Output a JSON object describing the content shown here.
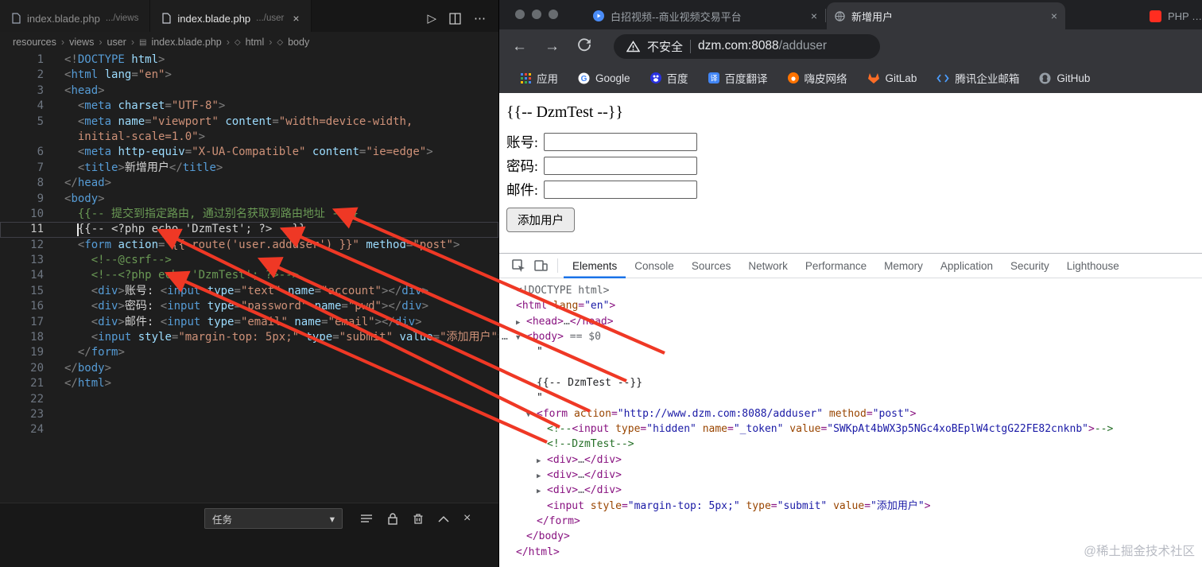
{
  "icons": {
    "close": "×",
    "run": "▷",
    "more": "⋯",
    "caret": "▾",
    "crumb_sep": "›",
    "tri_right": "▶",
    "tri_down": "▼",
    "back": "←",
    "forward": "→",
    "body_overflow": "…"
  },
  "colors": {
    "annotation_arrow": "#ef3825",
    "devtools_accent": "#1a73e8",
    "editor_bg": "#1e1e1e",
    "chrome_dark": "#35363a"
  },
  "editor": {
    "tabs": [
      {
        "title": "index.blade.php",
        "dir": ".../views"
      },
      {
        "title": "index.blade.php",
        "dir": ".../user"
      }
    ],
    "breadcrumb": [
      "resources",
      "views",
      "user",
      "index.blade.php",
      "html",
      "body"
    ],
    "panel": {
      "dropdown": "任务"
    },
    "lines": [
      {
        "n": "1",
        "t": [
          [
            "p",
            "<!"
          ],
          [
            "t",
            "DOCTYPE"
          ],
          [
            "a",
            " html"
          ],
          [
            "p",
            ">"
          ]
        ]
      },
      {
        "n": "2",
        "t": [
          [
            "p",
            "<"
          ],
          [
            "t",
            "html"
          ],
          [
            "a",
            " lang"
          ],
          [
            "p",
            "="
          ],
          [
            "v",
            "\"en\""
          ],
          [
            "p",
            ">"
          ]
        ]
      },
      {
        "n": "3",
        "t": [
          [
            "p",
            "<"
          ],
          [
            "t",
            "head"
          ],
          [
            "p",
            ">"
          ]
        ]
      },
      {
        "n": "4",
        "t": [
          [
            "w",
            "  "
          ],
          [
            "p",
            "<"
          ],
          [
            "t",
            "meta"
          ],
          [
            "a",
            " charset"
          ],
          [
            "p",
            "="
          ],
          [
            "v",
            "\"UTF-8\""
          ],
          [
            "p",
            ">"
          ]
        ]
      },
      {
        "n": "5",
        "t": [
          [
            "w",
            "  "
          ],
          [
            "p",
            "<"
          ],
          [
            "t",
            "meta"
          ],
          [
            "a",
            " name"
          ],
          [
            "p",
            "="
          ],
          [
            "v",
            "\"viewport\""
          ],
          [
            "a",
            " content"
          ],
          [
            "p",
            "="
          ],
          [
            "v",
            "\"width=device-width,"
          ]
        ]
      },
      {
        "n": "",
        "t": [
          [
            "w",
            "  "
          ],
          [
            "v",
            "initial-scale=1.0\""
          ],
          [
            "p",
            ">"
          ]
        ]
      },
      {
        "n": "6",
        "t": [
          [
            "w",
            "  "
          ],
          [
            "p",
            "<"
          ],
          [
            "t",
            "meta"
          ],
          [
            "a",
            " http-equiv"
          ],
          [
            "p",
            "="
          ],
          [
            "v",
            "\"X-UA-Compatible\""
          ],
          [
            "a",
            " content"
          ],
          [
            "p",
            "="
          ],
          [
            "v",
            "\"ie=edge\""
          ],
          [
            "p",
            ">"
          ]
        ]
      },
      {
        "n": "7",
        "t": [
          [
            "w",
            "  "
          ],
          [
            "p",
            "<"
          ],
          [
            "t",
            "title"
          ],
          [
            "p",
            ">"
          ],
          [
            "w",
            "新增用户"
          ],
          [
            "p",
            "</"
          ],
          [
            "t",
            "title"
          ],
          [
            "p",
            ">"
          ]
        ]
      },
      {
        "n": "8",
        "t": [
          [
            "p",
            "</"
          ],
          [
            "t",
            "head"
          ],
          [
            "p",
            ">"
          ]
        ]
      },
      {
        "n": "9",
        "t": [
          [
            "p",
            "<"
          ],
          [
            "t",
            "body"
          ],
          [
            "p",
            ">"
          ]
        ]
      },
      {
        "n": "10",
        "t": [
          [
            "w",
            "  "
          ],
          [
            "c",
            "{{-- 提交到指定路由, 通过别名获取到路由地址 --}}"
          ]
        ]
      },
      {
        "n": "11",
        "cur": true,
        "t": [
          [
            "w",
            "  {{-- <?php echo 'DzmTest'; ?> --}}"
          ]
        ]
      },
      {
        "n": "12",
        "t": [
          [
            "w",
            "  "
          ],
          [
            "p",
            "<"
          ],
          [
            "t",
            "form"
          ],
          [
            "a",
            " action"
          ],
          [
            "p",
            "="
          ],
          [
            "v",
            "\"{{ route('user.adduser') }}\""
          ],
          [
            "a",
            " method"
          ],
          [
            "p",
            "="
          ],
          [
            "v",
            "\"post\""
          ],
          [
            "p",
            ">"
          ]
        ]
      },
      {
        "n": "13",
        "t": [
          [
            "w",
            "    "
          ],
          [
            "c",
            "<!--@csrf-->"
          ]
        ]
      },
      {
        "n": "14",
        "t": [
          [
            "w",
            "    "
          ],
          [
            "c",
            "<!--<?php echo 'DzmTest'; ?>-->"
          ]
        ]
      },
      {
        "n": "15",
        "t": [
          [
            "w",
            "    "
          ],
          [
            "p",
            "<"
          ],
          [
            "t",
            "div"
          ],
          [
            "p",
            ">"
          ],
          [
            "w",
            "账号: "
          ],
          [
            "p",
            "<"
          ],
          [
            "t",
            "input"
          ],
          [
            "a",
            " type"
          ],
          [
            "p",
            "="
          ],
          [
            "v",
            "\"text\""
          ],
          [
            "a",
            " name"
          ],
          [
            "p",
            "="
          ],
          [
            "v",
            "\"account\""
          ],
          [
            "p",
            "></"
          ],
          [
            "t",
            "div"
          ],
          [
            "p",
            ">"
          ]
        ]
      },
      {
        "n": "16",
        "t": [
          [
            "w",
            "    "
          ],
          [
            "p",
            "<"
          ],
          [
            "t",
            "div"
          ],
          [
            "p",
            ">"
          ],
          [
            "w",
            "密码: "
          ],
          [
            "p",
            "<"
          ],
          [
            "t",
            "input"
          ],
          [
            "a",
            " type"
          ],
          [
            "p",
            "="
          ],
          [
            "v",
            "\"password\""
          ],
          [
            "a",
            " name"
          ],
          [
            "p",
            "="
          ],
          [
            "v",
            "\"pwd\""
          ],
          [
            "p",
            "></"
          ],
          [
            "t",
            "div"
          ],
          [
            "p",
            ">"
          ]
        ]
      },
      {
        "n": "17",
        "t": [
          [
            "w",
            "    "
          ],
          [
            "p",
            "<"
          ],
          [
            "t",
            "div"
          ],
          [
            "p",
            ">"
          ],
          [
            "w",
            "邮件: "
          ],
          [
            "p",
            "<"
          ],
          [
            "t",
            "input"
          ],
          [
            "a",
            " type"
          ],
          [
            "p",
            "="
          ],
          [
            "v",
            "\"email\""
          ],
          [
            "a",
            " name"
          ],
          [
            "p",
            "="
          ],
          [
            "v",
            "\"email\""
          ],
          [
            "p",
            "></"
          ],
          [
            "t",
            "div"
          ],
          [
            "p",
            ">"
          ]
        ]
      },
      {
        "n": "18",
        "t": [
          [
            "w",
            "    "
          ],
          [
            "p",
            "<"
          ],
          [
            "t",
            "input"
          ],
          [
            "a",
            " style"
          ],
          [
            "p",
            "="
          ],
          [
            "v",
            "\"margin-top: 5px;\""
          ],
          [
            "a",
            " type"
          ],
          [
            "p",
            "="
          ],
          [
            "v",
            "\"submit\""
          ],
          [
            "a",
            " value"
          ],
          [
            "p",
            "="
          ],
          [
            "v",
            "\"添加用户\""
          ],
          [
            "p",
            ">"
          ]
        ]
      },
      {
        "n": "19",
        "t": [
          [
            "w",
            "  "
          ],
          [
            "p",
            "</"
          ],
          [
            "t",
            "form"
          ],
          [
            "p",
            ">"
          ]
        ]
      },
      {
        "n": "20",
        "t": [
          [
            "p",
            "</"
          ],
          [
            "t",
            "body"
          ],
          [
            "p",
            ">"
          ]
        ]
      },
      {
        "n": "21",
        "t": [
          [
            "p",
            "</"
          ],
          [
            "t",
            "html"
          ],
          [
            "p",
            ">"
          ]
        ]
      },
      {
        "n": "22",
        "t": []
      },
      {
        "n": "23",
        "t": []
      },
      {
        "n": "24",
        "t": []
      }
    ]
  },
  "browser": {
    "tabs": [
      {
        "title": "白招视频--商业视频交易平台"
      },
      {
        "title": "新增用户"
      },
      {
        "title": "PHP - Laravel"
      }
    ],
    "nav": {
      "security": "不安全",
      "host": "dzm.com:8088",
      "path": "/adduser"
    },
    "bookmarks": [
      "应用",
      "Google",
      "百度",
      "百度翻译",
      "嗨皮网络",
      "GitLab",
      "腾讯企业邮箱",
      "GitHub"
    ],
    "page": {
      "heading": "{{-- DzmTest --}}",
      "fields": [
        "账号:",
        "密码:",
        "邮件:"
      ],
      "submit": "添加用户"
    },
    "devtools": {
      "tabs": [
        "Elements",
        "Console",
        "Sources",
        "Network",
        "Performance",
        "Memory",
        "Application",
        "Security",
        "Lighthouse"
      ],
      "active_tab": "Elements",
      "watermark": "@稀土掘金技术社区",
      "dom": [
        {
          "i": 0,
          "a": "",
          "t": [
            [
              "dg",
              "<!DOCTYPE html>"
            ]
          ]
        },
        {
          "i": 0,
          "a": "",
          "t": [
            [
              "dt",
              "<html"
            ],
            [
              "da",
              " lang"
            ],
            [
              "dt",
              "="
            ],
            [
              "dv",
              "\"en\""
            ],
            [
              "dt",
              ">"
            ]
          ]
        },
        {
          "i": 1,
          "a": "r",
          "t": [
            [
              "dt",
              "<head>"
            ],
            [
              "dg",
              "…"
            ],
            [
              "dt",
              "</head>"
            ]
          ]
        },
        {
          "i": 1,
          "a": "d",
          "pre": "…",
          "t": [
            [
              "dt",
              "<body>"
            ],
            [
              "dg",
              " == $0"
            ]
          ]
        },
        {
          "i": 2,
          "a": "",
          "t": [
            [
              "dk",
              "\""
            ]
          ]
        },
        {
          "i": 2,
          "a": "",
          "t": []
        },
        {
          "i": 2,
          "a": "",
          "t": [
            [
              "dk",
              "{{-- DzmTest --}}"
            ]
          ]
        },
        {
          "i": 2,
          "a": "",
          "t": [
            [
              "dk",
              "\""
            ]
          ]
        },
        {
          "i": 2,
          "a": "d",
          "t": [
            [
              "dt",
              "<form"
            ],
            [
              "da",
              " action"
            ],
            [
              "dt",
              "="
            ],
            [
              "dv",
              "\"http://www.dzm.com:8088/adduser\""
            ],
            [
              "da",
              " method"
            ],
            [
              "dt",
              "="
            ],
            [
              "dv",
              "\"post\""
            ],
            [
              "dt",
              ">"
            ]
          ]
        },
        {
          "i": 3,
          "a": "",
          "t": [
            [
              "dc",
              "<!--"
            ],
            [
              "dt",
              "<input"
            ],
            [
              "da",
              " type"
            ],
            [
              "dt",
              "="
            ],
            [
              "dv",
              "\"hidden\""
            ],
            [
              "da",
              " name"
            ],
            [
              "dt",
              "="
            ],
            [
              "dv",
              "\"_token\""
            ],
            [
              "da",
              " value"
            ],
            [
              "dt",
              "="
            ],
            [
              "dv",
              "\"SWKpAt4bWX3p5NGc4xoBEplW4ctgG22FE82cnknb\""
            ],
            [
              "dt",
              ">"
            ],
            [
              "dc",
              "-->"
            ]
          ]
        },
        {
          "i": 3,
          "a": "",
          "t": [
            [
              "dc",
              "<!--DzmTest-->"
            ]
          ]
        },
        {
          "i": 3,
          "a": "r",
          "t": [
            [
              "dt",
              "<div>"
            ],
            [
              "dg",
              "…"
            ],
            [
              "dt",
              "</div>"
            ]
          ]
        },
        {
          "i": 3,
          "a": "r",
          "t": [
            [
              "dt",
              "<div>"
            ],
            [
              "dg",
              "…"
            ],
            [
              "dt",
              "</div>"
            ]
          ]
        },
        {
          "i": 3,
          "a": "r",
          "t": [
            [
              "dt",
              "<div>"
            ],
            [
              "dg",
              "…"
            ],
            [
              "dt",
              "</div>"
            ]
          ]
        },
        {
          "i": 3,
          "a": "",
          "t": [
            [
              "dt",
              "<input"
            ],
            [
              "da",
              " style"
            ],
            [
              "dt",
              "="
            ],
            [
              "dv",
              "\"margin-top: 5px;\""
            ],
            [
              "da",
              " type"
            ],
            [
              "dt",
              "="
            ],
            [
              "dv",
              "\"submit\""
            ],
            [
              "da",
              " value"
            ],
            [
              "dt",
              "="
            ],
            [
              "dv",
              "\"添加用户\""
            ],
            [
              "dt",
              ">"
            ]
          ]
        },
        {
          "i": 2,
          "a": "",
          "t": [
            [
              "dt",
              "</form>"
            ]
          ]
        },
        {
          "i": 1,
          "a": "",
          "t": [
            [
              "dt",
              "</body>"
            ]
          ]
        },
        {
          "i": 0,
          "a": "",
          "t": [
            [
              "dt",
              "</html>"
            ]
          ]
        }
      ]
    }
  }
}
